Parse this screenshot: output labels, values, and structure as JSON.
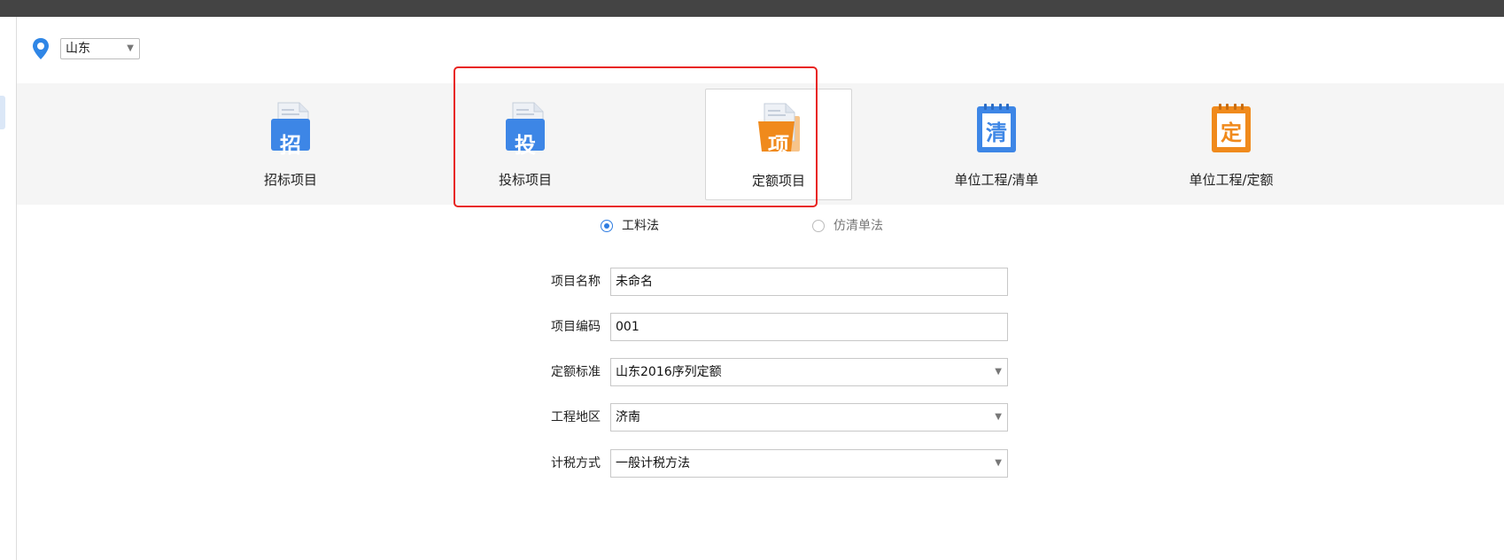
{
  "location": {
    "icon": "location-pin-icon",
    "selected_region": "山东"
  },
  "project_types": [
    {
      "label": "招标项目",
      "icon_char": "招",
      "icon_color": "#3d86e6",
      "icon": "tender-project-icon",
      "selected": false
    },
    {
      "label": "投标项目",
      "icon_char": "投",
      "icon_color": "#3d86e6",
      "icon": "bid-project-icon",
      "selected": false
    },
    {
      "label": "定额项目",
      "icon_char": "项",
      "icon_color": "#f08a1c",
      "icon": "quota-project-icon",
      "selected": true
    },
    {
      "label": "单位工程/清单",
      "icon_char": "清",
      "icon_color": "#3d86e6",
      "icon": "unit-bill-icon",
      "selected": false
    },
    {
      "label": "单位工程/定额",
      "icon_char": "定",
      "icon_color": "#f08a1c",
      "icon": "unit-quota-icon",
      "selected": false
    }
  ],
  "methods": {
    "labor_material": "工料法",
    "pseudo_bill": "仿清单法",
    "selected": "工料法"
  },
  "form": {
    "project_name": {
      "label": "项目名称",
      "value": "未命名"
    },
    "project_code": {
      "label": "项目编码",
      "value": "001"
    },
    "quota_standard": {
      "label": "定额标准",
      "value": "山东2016序列定额"
    },
    "project_region": {
      "label": "工程地区",
      "value": "济南"
    },
    "tax_method": {
      "label": "计税方式",
      "value": "一般计税方法"
    }
  },
  "colors": {
    "accent_blue": "#2f7de1",
    "highlight_red": "#e8231f",
    "topbar": "#444444"
  }
}
